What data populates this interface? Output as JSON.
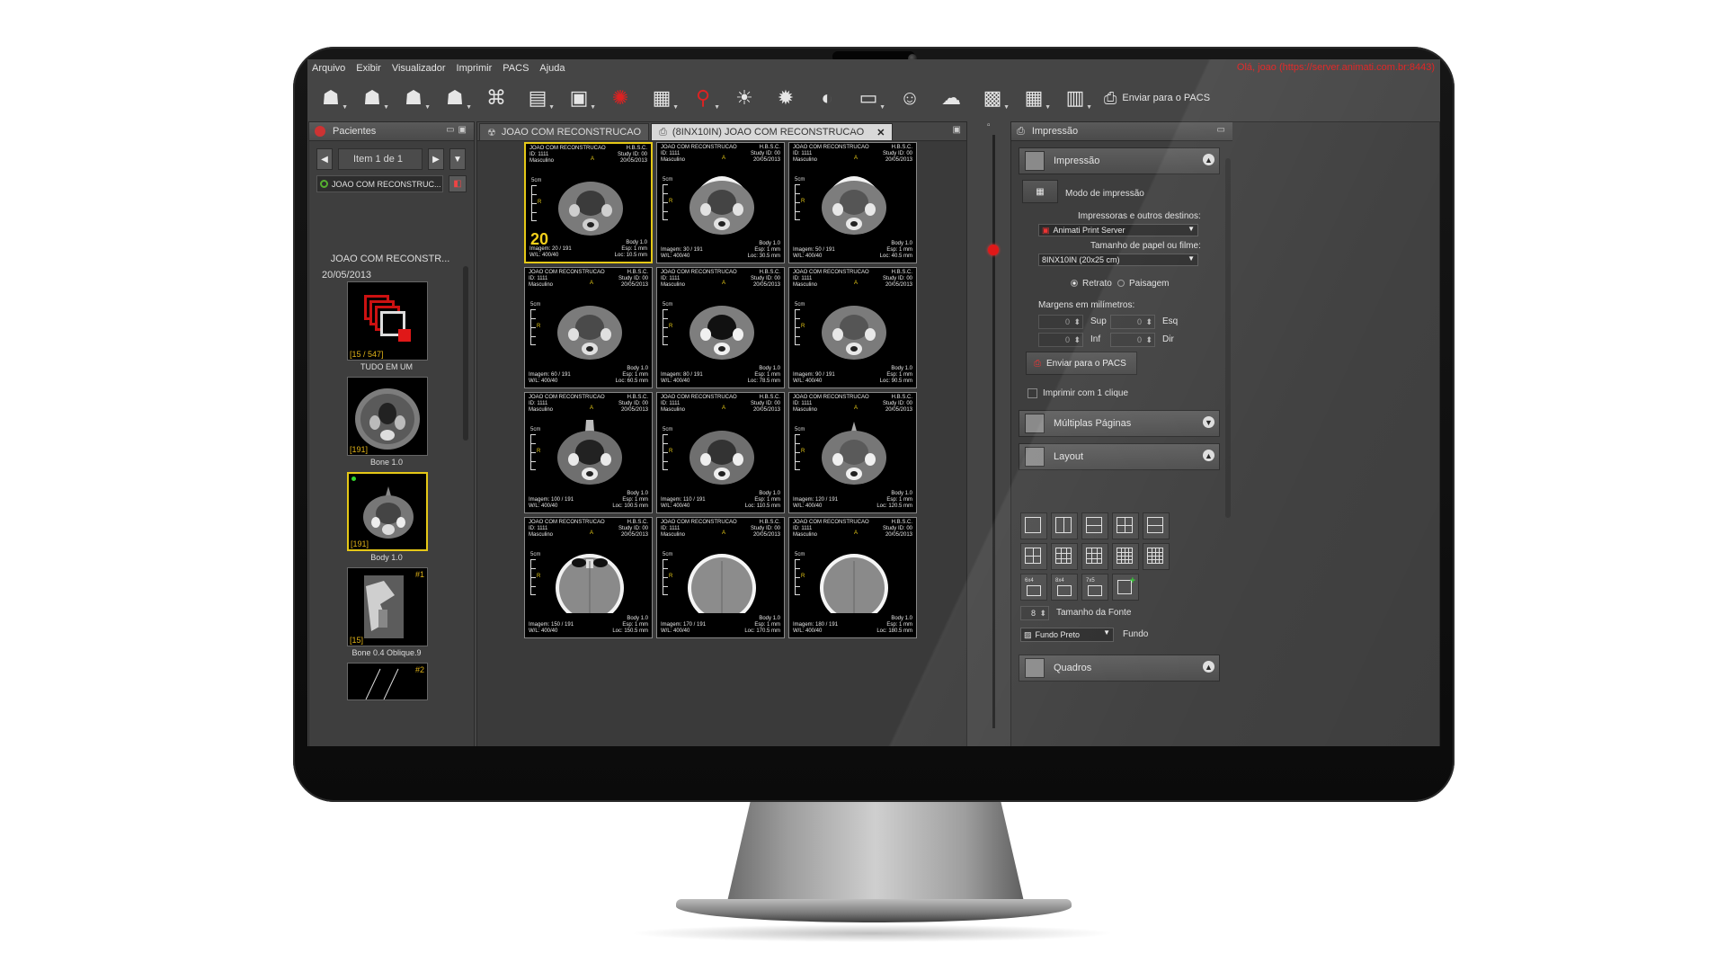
{
  "menu": [
    "Arquivo",
    "Exibir",
    "Visualizador",
    "Imprimir",
    "PACS",
    "Ajuda"
  ],
  "connection_text": "Olá, joao (https://server.animati.com.br:8443)",
  "toolbar": {
    "icons": [
      "open-patient-icon",
      "search-patient-icon",
      "download-icon",
      "upload-icon",
      "network-icon",
      "monitor-icon",
      "patient-card-icon",
      "wheel-icon",
      "film-icon",
      "zoom-icon",
      "brightness-icon",
      "contrast-icon",
      "invert-icon",
      "screen-layout-icon",
      "users-icon",
      "cloud-icon",
      "print-screen-icon",
      "grid-select-icon",
      "series-icon"
    ],
    "send_label": "Enviar para o PACS"
  },
  "patients_panel": {
    "title": "Pacientes",
    "nav_text": "Item 1 de 1",
    "series_select": "JOAO COM RECONSTRUC...",
    "patient_name": "JOAO COM RECONSTR...",
    "patient_date": "20/05/2013",
    "thumbnails": [
      {
        "label": "TUDO EM UM",
        "count": "[15 / 547]",
        "index": "",
        "kind": "allinone"
      },
      {
        "label": "Bone 1.0",
        "count": "[191]",
        "index": "",
        "kind": "axial"
      },
      {
        "label": "Body 1.0",
        "count": "[191]",
        "index": "",
        "kind": "axial"
      },
      {
        "label": "Bone 0.4 Oblique.9",
        "count": "[15]",
        "index": "#1",
        "kind": "oblique"
      },
      {
        "label": "",
        "count": "",
        "index": "#2",
        "kind": "lines"
      }
    ]
  },
  "viewer": {
    "tabs": [
      {
        "label": "JOAO COM RECONSTRUCAO",
        "active": false
      },
      {
        "label": "(8INX10IN) JOAO COM RECONSTRUCAO",
        "active": true
      }
    ],
    "overflow": "»",
    "selected_number": "20",
    "cells": [
      {
        "name": "JOAO COM RECONSTRUCAO",
        "id": "ID: 1111",
        "sex": "Masculino",
        "inst": "H.B.S.C.",
        "study": "Study ID: 00",
        "date": "20/05/2013",
        "series": "Body 1.0",
        "esp": "Esp: 1 mm",
        "img": "Imagem: 20 / 191",
        "wl": "W/L: 400/40",
        "loc": "Loc: 10.5 mm"
      },
      {
        "name": "JOAO COM RECONSTRUCAO",
        "id": "ID: 1111",
        "sex": "Masculino",
        "inst": "H.B.S.C.",
        "study": "Study ID: 00",
        "date": "20/05/2013",
        "series": "Body 1.0",
        "esp": "Esp: 1 mm",
        "img": "Imagem: 30 / 191",
        "wl": "W/L: 400/40",
        "loc": "Loc: 30.5 mm"
      },
      {
        "name": "JOAO COM RECONSTRUCAO",
        "id": "ID: 1111",
        "sex": "Masculino",
        "inst": "H.B.S.C.",
        "study": "Study ID: 00",
        "date": "20/05/2013",
        "series": "Body 1.0",
        "esp": "Esp: 1 mm",
        "img": "Imagem: 50 / 191",
        "wl": "W/L: 400/40",
        "loc": "Loc: 40.5 mm"
      },
      {
        "name": "JOAO COM RECONSTRUCAO",
        "id": "ID: 1111",
        "sex": "Masculino",
        "inst": "H.B.S.C.",
        "study": "Study ID: 00",
        "date": "20/05/2013",
        "series": "Body 1.0",
        "esp": "Esp: 1 mm",
        "img": "Imagem: 60 / 191",
        "wl": "W/L: 400/40",
        "loc": "Loc: 60.5 mm"
      },
      {
        "name": "JOAO COM RECONSTRUCAO",
        "id": "ID: 1111",
        "sex": "Masculino",
        "inst": "H.B.S.C.",
        "study": "Study ID: 00",
        "date": "20/05/2013",
        "series": "Body 1.0",
        "esp": "Esp: 1 mm",
        "img": "Imagem: 80 / 191",
        "wl": "W/L: 400/40",
        "loc": "Loc: 78.5 mm"
      },
      {
        "name": "JOAO COM RECONSTRUCAO",
        "id": "ID: 1111",
        "sex": "Masculino",
        "inst": "H.B.S.C.",
        "study": "Study ID: 00",
        "date": "20/05/2013",
        "series": "Body 1.0",
        "esp": "Esp: 1 mm",
        "img": "Imagem: 90 / 191",
        "wl": "W/L: 400/40",
        "loc": "Loc: 90.5 mm"
      },
      {
        "name": "JOAO COM RECONSTRUCAO",
        "id": "ID: 1111",
        "sex": "Masculino",
        "inst": "H.B.S.C.",
        "study": "Study ID: 00",
        "date": "20/05/2013",
        "series": "Body 1.0",
        "esp": "Esp: 1 mm",
        "img": "Imagem: 100 / 191",
        "wl": "W/L: 400/40",
        "loc": "Loc: 100.5 mm"
      },
      {
        "name": "JOAO COM RECONSTRUCAO",
        "id": "ID: 1111",
        "sex": "Masculino",
        "inst": "H.B.S.C.",
        "study": "Study ID: 00",
        "date": "20/05/2013",
        "series": "Body 1.0",
        "esp": "Esp: 1 mm",
        "img": "Imagem: 110 / 191",
        "wl": "W/L: 400/40",
        "loc": "Loc: 110.5 mm"
      },
      {
        "name": "JOAO COM RECONSTRUCAO",
        "id": "ID: 1111",
        "sex": "Masculino",
        "inst": "H.B.S.C.",
        "study": "Study ID: 00",
        "date": "20/05/2013",
        "series": "Body 1.0",
        "esp": "Esp: 1 mm",
        "img": "Imagem: 120 / 191",
        "wl": "W/L: 400/40",
        "loc": "Loc: 120.5 mm"
      },
      {
        "name": "JOAO COM RECONSTRUCAO",
        "id": "ID: 1111",
        "sex": "Masculino",
        "inst": "H.B.S.C.",
        "study": "Study ID: 00",
        "date": "20/05/2013",
        "series": "Body 1.0",
        "esp": "Esp: 1 mm",
        "img": "Imagem: 150 / 191",
        "wl": "W/L: 400/40",
        "loc": "Loc: 150.5 mm"
      },
      {
        "name": "JOAO COM RECONSTRUCAO",
        "id": "ID: 1111",
        "sex": "Masculino",
        "inst": "H.B.S.C.",
        "study": "Study ID: 00",
        "date": "20/05/2013",
        "series": "Body 1.0",
        "esp": "Esp: 1 mm",
        "img": "Imagem: 170 / 191",
        "wl": "W/L: 400/40",
        "loc": "Loc: 170.5 mm"
      },
      {
        "name": "JOAO COM RECONSTRUCAO",
        "id": "ID: 1111",
        "sex": "Masculino",
        "inst": "H.B.S.C.",
        "study": "Study ID: 00",
        "date": "20/05/2013",
        "series": "Body 1.0",
        "esp": "Esp: 1 mm",
        "img": "Imagem: 180 / 191",
        "wl": "W/L: 400/40",
        "loc": "Loc: 180.5 mm"
      }
    ],
    "orientation_a": "A",
    "orientation_r": "R",
    "ruler_label": "5cm"
  },
  "print_panel": {
    "title": "Impressão",
    "section_print": "Impressão",
    "print_mode_label": "Modo de impressão",
    "printers_label": "Impressoras e outros destinos:",
    "printer_value": "Animati Print Server",
    "paper_label": "Tamanho de papel ou filme:",
    "paper_value": "8INX10IN (20x25 cm)",
    "portrait_label": "Retrato",
    "landscape_label": "Paisagem",
    "margins_label": "Margens em milímetros:",
    "margin_top_label": "Sup",
    "margin_left_label": "Esq",
    "margin_bottom_label": "Inf",
    "margin_right_label": "Dir",
    "margin_values": [
      "0",
      "0",
      "0",
      "0"
    ],
    "send_pacs_label": "Enviar para o PACS",
    "one_click_label": "Imprimir com 1 clique",
    "section_multi": "Múltiplas Páginas",
    "section_layout": "Layout",
    "layout_custom_labels": [
      "6x4",
      "8x4",
      "7x5"
    ],
    "font_size_value": "8",
    "font_size_label": "Tamanho da Fonte",
    "background_value": "Fundo Preto",
    "background_label": "Fundo",
    "section_frames": "Quadros"
  },
  "colors": {
    "accent_red": "#e01818",
    "selection_yellow": "#e5c817",
    "panel_gray": "#3e3e3e"
  }
}
